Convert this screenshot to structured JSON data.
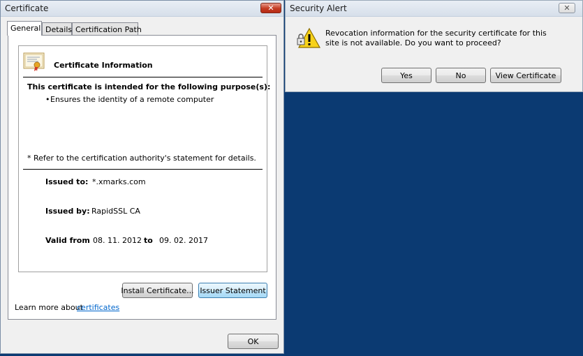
{
  "certificate_window": {
    "title": "Certificate",
    "close_symbol": "✕",
    "tabs": [
      {
        "label": "General",
        "active": true
      },
      {
        "label": "Details",
        "active": false
      },
      {
        "label": "Certification Path",
        "active": false
      }
    ],
    "info_title": "Certificate Information",
    "purpose_heading": "This certificate is intended for the following purpose(s):",
    "purposes": [
      "Ensures the identity of a remote computer"
    ],
    "bullet": "•",
    "refer_note": "* Refer to the certification authority's statement for details.",
    "issued_to_label": "Issued to:",
    "issued_to_value": "*.xmarks.com",
    "issued_by_label": "Issued by:",
    "issued_by_value": "RapidSSL CA",
    "valid_from_label": "Valid from",
    "valid_from_value": "08. 11. 2012",
    "valid_to_label": "to",
    "valid_to_value": "09. 02. 2017",
    "install_button": "Install Certificate...",
    "issuer_button": "Issuer Statement",
    "learn_more_text": "Learn more about",
    "learn_more_link": "certificates",
    "ok_button": "OK",
    "icon": "certificate-icon"
  },
  "security_alert": {
    "title": "Security Alert",
    "close_symbol": "✕",
    "message": "Revocation information for the security certificate for this site is not available. Do you want to proceed?",
    "buttons": {
      "yes": "Yes",
      "no": "No",
      "view": "View Certificate"
    },
    "icon": "warning-lock-icon"
  },
  "colors": {
    "desktop": "#0b3a72",
    "window_bg": "#f0f0f0",
    "close_red": "#c33b22",
    "link": "#0066cc"
  }
}
